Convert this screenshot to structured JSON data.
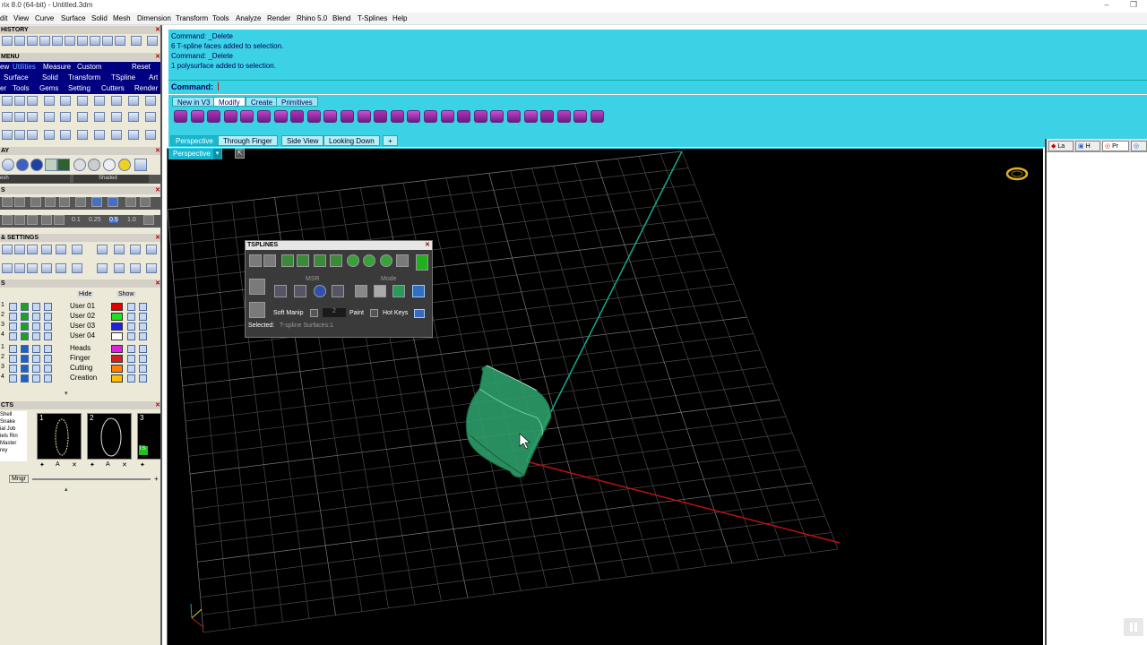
{
  "window": {
    "title": "rix 8.0 (64-bit) - Untitled.3dm",
    "minimize": "–",
    "maximize": "❐"
  },
  "menu": [
    "dit",
    "View",
    "Curve",
    "Surface",
    "Solid",
    "Mesh",
    "Dimension",
    "Transform",
    "Tools",
    "Analyze",
    "Render",
    "Rhino 5.0",
    "Blend",
    "T-Splines",
    "Help"
  ],
  "left_panel": {
    "history_title": "HISTORY",
    "menu_title": "MENU",
    "menu_tabs": [
      "ew",
      "Utilities",
      "Measure",
      "Custom",
      "Reset"
    ],
    "menu_row2": [
      "Surface",
      "Solid",
      "Transform",
      "TSpline",
      "Art"
    ],
    "menu_row3": [
      "er",
      "Tools",
      "Gems",
      "Setting",
      "Cutters",
      "Render"
    ],
    "display_title": "AY",
    "display_mode_a": "esh",
    "display_mode_b": "Shaded",
    "snap_values": [
      "0.1",
      "0.25",
      "0.5",
      "1.0"
    ],
    "settings_title": "& SETTINGS",
    "layers_title": "S",
    "layers_hide": "Hide",
    "layers_show": "Show",
    "layers": [
      {
        "num": "1",
        "name": "User 01",
        "color": "#e00000"
      },
      {
        "num": "2",
        "name": "User 02",
        "color": "#20e020"
      },
      {
        "num": "3",
        "name": "User 03",
        "color": "#2020e0"
      },
      {
        "num": "4",
        "name": "User 04",
        "color": "#ffffff"
      },
      {
        "num": "1",
        "name": "Heads",
        "color": "#e020e0"
      },
      {
        "num": "2",
        "name": "Finger",
        "color": "#d02020"
      },
      {
        "num": "3",
        "name": "Cutting",
        "color": "#ff8000"
      },
      {
        "num": "4",
        "name": "Creation",
        "color": "#ffc000"
      }
    ],
    "objects_title": "CTS",
    "objects_list": [
      "Shell",
      "Snake",
      "ial Job",
      "iels Rin",
      "Master",
      "",
      "rey"
    ],
    "thumb_numbers": [
      "1",
      "2",
      "3"
    ],
    "mngr_label": "Mngr"
  },
  "command": {
    "history": [
      "Command: _Delete",
      "6 T-spline faces added to selection.",
      "Command: _Delete",
      "1 polysurface added to selection."
    ],
    "prompt_label": "Command:",
    "input_value": ""
  },
  "toolbar_tabs": [
    "New in V3",
    "Modify",
    "Create",
    "Primitives"
  ],
  "toolbar_active": "Modify",
  "viewport_tabs": [
    "Perspective",
    "Through Finger",
    "Side View",
    "Looking Down"
  ],
  "viewport_add": "+",
  "viewport_label": "Perspective",
  "tsplines_panel": {
    "title": "TSPLINES",
    "msr_label": "MSR",
    "mode_label": "Mode",
    "soft_manip_label": "Soft Manip",
    "soft_manip_value": "2",
    "paint_label": "Paint",
    "hot_keys_label": "Hot Keys",
    "selected_label": "Selected:",
    "selected_value": "T-spline Surfaces:1"
  },
  "right_panel": {
    "tabs": [
      "La",
      "H",
      "Pr",
      ""
    ]
  },
  "colors": {
    "command_bg": "#3cd2e6",
    "viewport_bg": "#000000",
    "grid": "#5a5a5a",
    "x_axis": "#c01010",
    "y_axis": "#18a890",
    "model": "#2e9e6a"
  }
}
